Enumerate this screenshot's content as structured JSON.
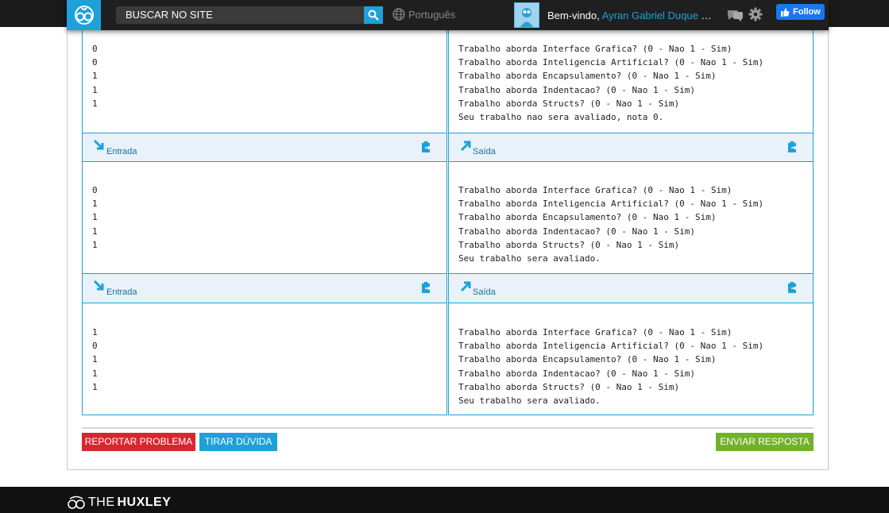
{
  "header": {
    "search_placeholder": "BUSCAR NO SITE",
    "language": "Português",
    "welcome_prefix": "Bem-vindo, ",
    "user_name": "Ayran Gabriel Duque Sou...",
    "follow_label": "Follow"
  },
  "io_rows": [
    {
      "input": [
        "0",
        "0",
        "1",
        "1",
        "1"
      ],
      "output": [
        "Trabalho aborda Interface Grafica? (0 - Nao 1 - Sim)",
        "Trabalho aborda Inteligencia Artificial? (0 - Nao 1 - Sim)",
        "Trabalho aborda Encapsulamento? (0 - Nao 1 - Sim)",
        "Trabalho aborda Indentacao? (0 - Nao 1 - Sim)",
        "Trabalho aborda Structs? (0 - Nao 1 - Sim)",
        "Seu trabalho nao sera avaliado, nota 0."
      ]
    },
    {
      "input_label": "Entrada",
      "output_label": "Saída",
      "input": [
        "0",
        "1",
        "1",
        "1",
        "1"
      ],
      "output": [
        "Trabalho aborda Interface Grafica? (0 - Nao 1 - Sim)",
        "Trabalho aborda Inteligencia Artificial? (0 - Nao 1 - Sim)",
        "Trabalho aborda Encapsulamento? (0 - Nao 1 - Sim)",
        "Trabalho aborda Indentacao? (0 - Nao 1 - Sim)",
        "Trabalho aborda Structs? (0 - Nao 1 - Sim)",
        "Seu trabalho sera avaliado."
      ]
    },
    {
      "input_label": "Entrada",
      "output_label": "Saída",
      "input": [
        "1",
        "0",
        "1",
        "1",
        "1"
      ],
      "output": [
        "Trabalho aborda Interface Grafica? (0 - Nao 1 - Sim)",
        "Trabalho aborda Inteligencia Artificial? (0 - Nao 1 - Sim)",
        "Trabalho aborda Encapsulamento? (0 - Nao 1 - Sim)",
        "Trabalho aborda Indentacao? (0 - Nao 1 - Sim)",
        "Trabalho aborda Structs? (0 - Nao 1 - Sim)",
        "Seu trabalho sera avaliado."
      ]
    }
  ],
  "actions": {
    "report_label": "REPORTAR PROBLEMA",
    "doubt_label": "TIRAR DÚVIDA",
    "send_label": "ENVIAR RESPOSTA"
  },
  "footer": {
    "brand_light": "THE",
    "brand_bold": "HUXLEY"
  },
  "colors": {
    "accent": "#1ea1d9",
    "danger": "#d9262e",
    "success": "#72b12a",
    "header_bg": "#1f1f1f"
  }
}
